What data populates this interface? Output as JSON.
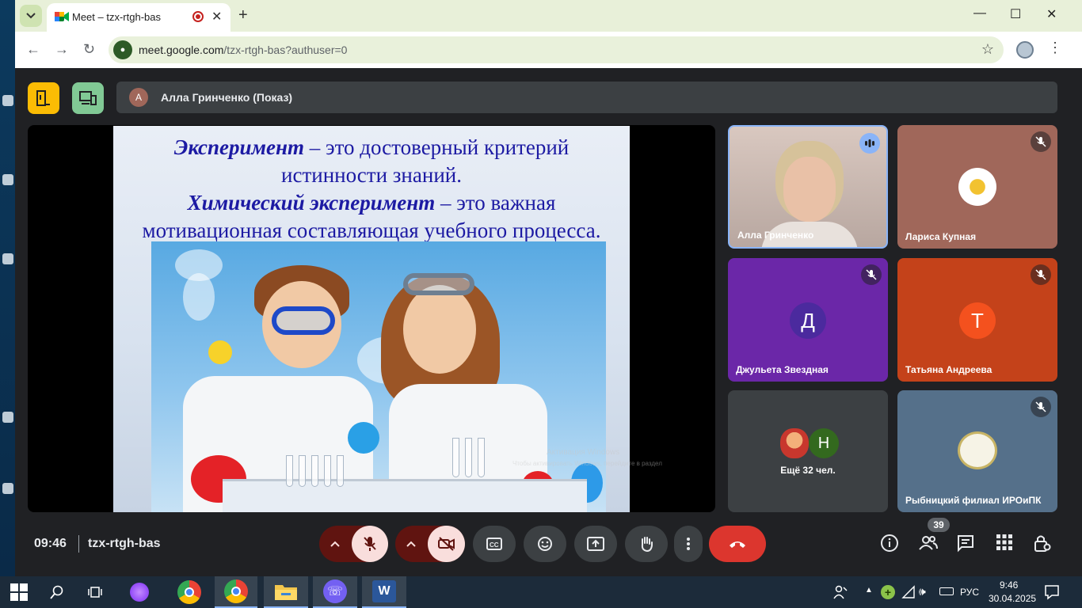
{
  "browser": {
    "tab_title": "Meet – tzx-rtgh-bas",
    "new_tab_label": "+",
    "url_host": "meet.google.com",
    "url_path": "/tzx-rtgh-bas?authuser=0"
  },
  "meet": {
    "presenter_initial": "А",
    "presenter_label": "Алла Гринченко (Показ)",
    "slide": {
      "line1_em": "Эксперимент",
      "line1_rest": " – это достоверный критерий",
      "line2": "истинности знаний.",
      "line3_em": "Химический эксперимент",
      "line3_rest": " – это важная",
      "line4": "мотивационная составляющая учебного процесса."
    },
    "watermark": {
      "line1": "Активация Windows",
      "line2": "Чтобы активировать Windows, перейдите в раздел"
    },
    "participants": [
      {
        "name": "Алла Гринченко",
        "state": "speaking"
      },
      {
        "name": "Лариса Купная",
        "state": "muted"
      },
      {
        "name": "Джульета Звездная",
        "initial": "Д",
        "color": "#4b2a9e",
        "state": "muted"
      },
      {
        "name": "Татьяна Андреева",
        "initial": "Т",
        "color": "#f4511e",
        "state": "muted"
      },
      {
        "name": "Ещё 32 чел.",
        "initial": "Н",
        "color": "#33691e"
      },
      {
        "name": "Рыбницкий филиал ИРОиПК",
        "state": "muted"
      }
    ],
    "time": "09:46",
    "meeting_code": "tzx-rtgh-bas",
    "people_count": "39"
  },
  "taskbar": {
    "language": "РУС",
    "time": "9:46",
    "date": "30.04.2025"
  },
  "colors": {
    "accent_red": "#dc362e",
    "muted_red_bg": "#f9dedc",
    "speaking_blue": "#8ab4f8",
    "slide_text": "#1c1aa3"
  }
}
